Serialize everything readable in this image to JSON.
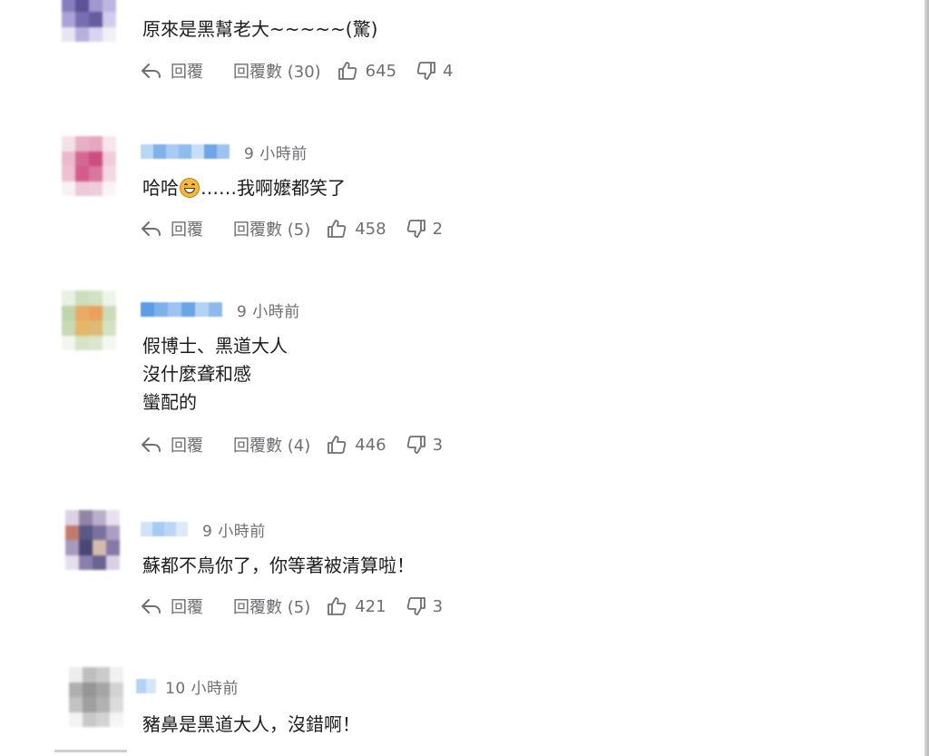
{
  "comments": [
    {
      "time": "",
      "text": "原來是黑幫老大~~~~~(驚)",
      "reply_label": "回覆",
      "replies_label": "回覆數 (30)",
      "likes": "645",
      "dislikes": "4"
    },
    {
      "time": "9 小時前",
      "text_before_emoji": "哈哈",
      "emoji": "grinning-face-emoji",
      "text_after_emoji": "……我啊嬤都笑了",
      "reply_label": "回覆",
      "replies_label": "回覆數 (5)",
      "likes": "458",
      "dislikes": "2"
    },
    {
      "time": "9 小時前",
      "text": "假博士、黑道大人\n沒什麼聋和感\n蠻配的",
      "reply_label": "回覆",
      "replies_label": "回覆數 (4)",
      "likes": "446",
      "dislikes": "3"
    },
    {
      "time": "9 小時前",
      "text": "蘇都不鳥你了，你等著被清算啦！",
      "reply_label": "回覆",
      "replies_label": "回覆數 (5)",
      "likes": "421",
      "dislikes": "3"
    },
    {
      "time": "10 小時前",
      "text": "豬鼻是黑道大人，沒錯啊！"
    }
  ],
  "icons": {
    "reply": "reply-arrow-icon",
    "like": "thumbs-up-icon",
    "dislike": "thumbs-down-icon"
  },
  "colors": {
    "text": "#1d1d1f",
    "muted": "#6e6e73",
    "username_blur": "#9cc3f0"
  }
}
